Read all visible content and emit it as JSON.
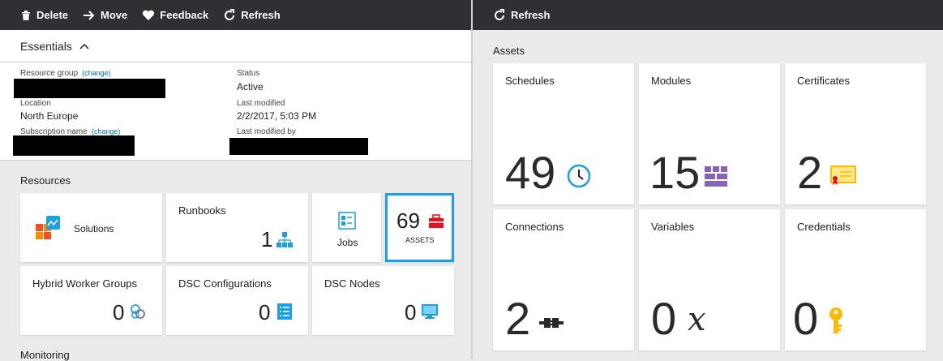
{
  "left_toolbar": {
    "delete": "Delete",
    "move": "Move",
    "feedback": "Feedback",
    "refresh": "Refresh"
  },
  "right_toolbar": {
    "refresh": "Refresh"
  },
  "essentials": {
    "title": "Essentials",
    "resource_group_label": "Resource group",
    "change": "(change)",
    "location_label": "Location",
    "location_value": "North Europe",
    "subscription_label": "Subscription name",
    "status_label": "Status",
    "status_value": "Active",
    "last_modified_label": "Last modified",
    "last_modified_value": "2/2/2017, 5:03 PM",
    "last_modified_by_label": "Last modified by"
  },
  "resources": {
    "title": "Resources",
    "solutions": "Solutions",
    "runbooks": {
      "title": "Runbooks",
      "count": "1"
    },
    "jobs": "Jobs",
    "assets": {
      "count": "69",
      "label": "ASSETS"
    },
    "hybrid": {
      "title": "Hybrid Worker Groups",
      "count": "0"
    },
    "dsc_config": {
      "title": "DSC Configurations",
      "count": "0"
    },
    "dsc_nodes": {
      "title": "DSC Nodes",
      "count": "0"
    }
  },
  "monitoring": {
    "title": "Monitoring"
  },
  "assets_panel": {
    "title": "Assets",
    "tiles": [
      {
        "title": "Schedules",
        "count": "49"
      },
      {
        "title": "Modules",
        "count": "15"
      },
      {
        "title": "Certificates",
        "count": "2"
      },
      {
        "title": "Connections",
        "count": "2"
      },
      {
        "title": "Variables",
        "count": "0"
      },
      {
        "title": "Credentials",
        "count": "0"
      }
    ]
  },
  "colors": {
    "toolbar": "#2e3033",
    "accent_blue": "#1ba1e2",
    "assets_red": "#e81123",
    "modules_purple": "#8764b8",
    "cert_yellow": "#ffb900"
  }
}
